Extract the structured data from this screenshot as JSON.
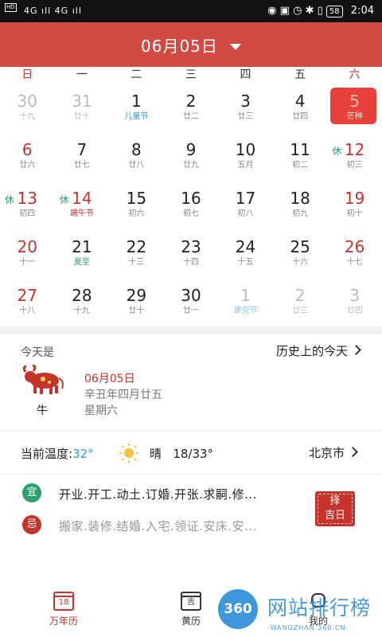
{
  "status_bar": {
    "left": "4G ıll 4G ıll",
    "hd": "HD",
    "battery": "58",
    "time": "2:04"
  },
  "header": {
    "title": "06月05日"
  },
  "weekdays": [
    "日",
    "一",
    "二",
    "三",
    "四",
    "五",
    "六"
  ],
  "calendar": [
    [
      {
        "day": "30",
        "lunar": "十九",
        "type": "dim"
      },
      {
        "day": "31",
        "lunar": "廿十",
        "type": "dim"
      },
      {
        "day": "1",
        "lunar": "儿童节",
        "type": "festival"
      },
      {
        "day": "2",
        "lunar": "廿二"
      },
      {
        "day": "3",
        "lunar": "廿三"
      },
      {
        "day": "4",
        "lunar": "廿四"
      },
      {
        "day": "5",
        "lunar": "芒种",
        "type": "selected"
      }
    ],
    [
      {
        "day": "6",
        "lunar": "廿六",
        "type": "red"
      },
      {
        "day": "7",
        "lunar": "廿七"
      },
      {
        "day": "8",
        "lunar": "廿八"
      },
      {
        "day": "9",
        "lunar": "廿九"
      },
      {
        "day": "10",
        "lunar": "五月"
      },
      {
        "day": "11",
        "lunar": "初二"
      },
      {
        "day": "12",
        "lunar": "初三",
        "type": "red",
        "hol": "休"
      }
    ],
    [
      {
        "day": "13",
        "lunar": "初四",
        "type": "red",
        "hol": "休"
      },
      {
        "day": "14",
        "lunar": "端午节",
        "type": "festival-red",
        "hol": "休"
      },
      {
        "day": "15",
        "lunar": "初六"
      },
      {
        "day": "16",
        "lunar": "初七"
      },
      {
        "day": "17",
        "lunar": "初八"
      },
      {
        "day": "18",
        "lunar": "初九"
      },
      {
        "day": "19",
        "lunar": "初十",
        "type": "red"
      }
    ],
    [
      {
        "day": "20",
        "lunar": "十一",
        "type": "red"
      },
      {
        "day": "21",
        "lunar": "夏至",
        "type": "festival-green"
      },
      {
        "day": "22",
        "lunar": "十三"
      },
      {
        "day": "23",
        "lunar": "十四"
      },
      {
        "day": "24",
        "lunar": "十五"
      },
      {
        "day": "25",
        "lunar": "十六"
      },
      {
        "day": "26",
        "lunar": "十七",
        "type": "red"
      }
    ],
    [
      {
        "day": "27",
        "lunar": "十八",
        "type": "red"
      },
      {
        "day": "28",
        "lunar": "十九"
      },
      {
        "day": "29",
        "lunar": "廿十"
      },
      {
        "day": "30",
        "lunar": "廿一"
      },
      {
        "day": "1",
        "lunar": "建党节",
        "type": "dim-festival"
      },
      {
        "day": "2",
        "lunar": "廿三",
        "type": "dim"
      },
      {
        "day": "3",
        "lunar": "廿四",
        "type": "dim"
      }
    ]
  ],
  "today": {
    "heading": "今天是",
    "history_link": "历史上的今天",
    "zodiac": "牛",
    "date": "06月05日",
    "lunar": "辛丑年四月廿五",
    "weekday": "星期六"
  },
  "weather": {
    "label": "当前温度:",
    "temp": "32°",
    "condition": "晴",
    "range": "18/33°",
    "city": "北京市"
  },
  "almanac": {
    "yi_label": "宜",
    "yi_text": "开业.开工.动土.订婚.开张.求嗣.修...",
    "ji_label": "忌",
    "ji_text": "搬家.装修.结婚.入宅.领证.安床.安...",
    "zeji_line1": "择",
    "zeji_line2": "吉日"
  },
  "tabs": [
    {
      "label": "万年历",
      "icon_text": "18"
    },
    {
      "label": "黄历",
      "icon_text": "吉"
    },
    {
      "label": "我的"
    }
  ],
  "watermark": {
    "logo": "360",
    "brand": "网站排行榜",
    "url": "-WANGZHAN.360.CN-"
  },
  "colors": {
    "brand_red": "#d24a44",
    "accent_red": "#c3342c",
    "yi_green": "#2aa06b",
    "temp_blue": "#2d9ad6"
  }
}
